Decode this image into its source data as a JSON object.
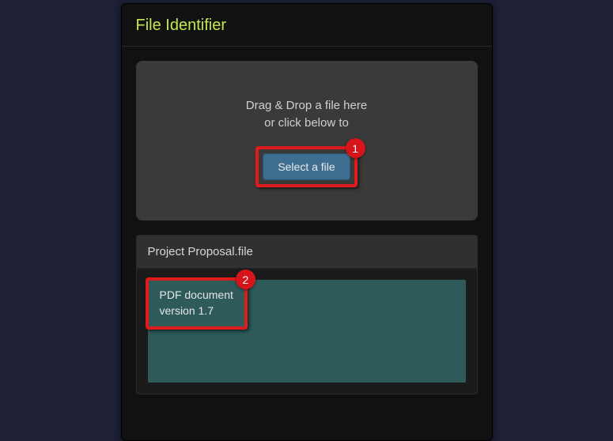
{
  "app": {
    "title": "File Identifier"
  },
  "dropzone": {
    "line1": "Drag & Drop a file here",
    "line2": "or click below to",
    "button_label": "Select a file"
  },
  "callouts": {
    "select_button": "1",
    "result_box": "2"
  },
  "result": {
    "filename": "Project Proposal.file",
    "output_line1": "PDF document",
    "output_line2": "version 1.7"
  },
  "colors": {
    "accent": "#c5e84c",
    "highlight": "#e11b1b",
    "button": "#3f6f90",
    "output_bg": "#2e5a5a"
  }
}
